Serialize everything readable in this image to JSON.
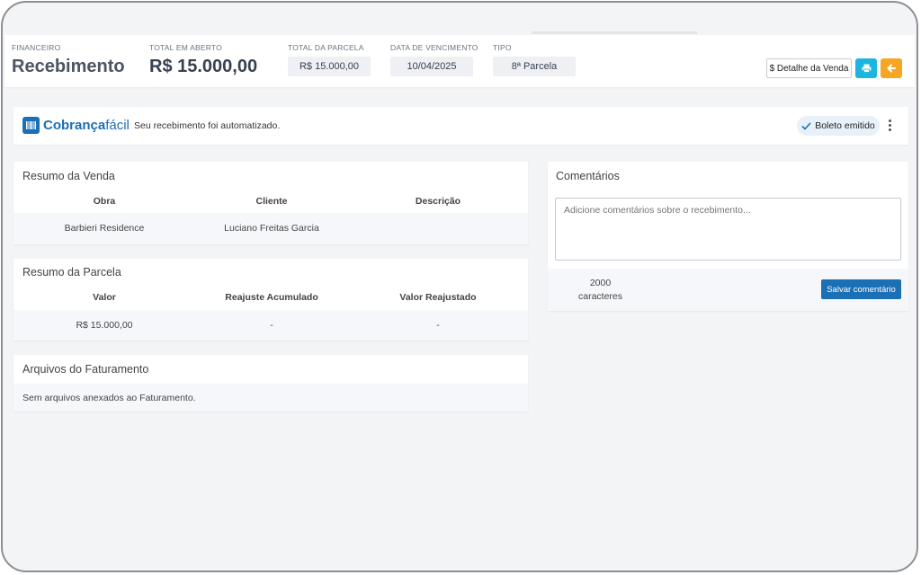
{
  "header": {
    "section_label": "FINANCEIRO",
    "title": "Recebimento",
    "total_aberto_label": "TOTAL EM ABERTO",
    "total_aberto_value": "R$ 15.000,00",
    "total_parcela_label": "TOTAL DA PARCELA",
    "total_parcela_value": "R$ 15.000,00",
    "vencimento_label": "DATA DE VENCIMENTO",
    "vencimento_value": "10/04/2025",
    "tipo_label": "TIPO",
    "tipo_value": "8ª Parcela",
    "detalhe_button": "$ Detalhe da Venda",
    "print_icon": "printer-icon",
    "back_icon": "arrow-left-icon"
  },
  "cobranca": {
    "logo_bold": "Cobrança",
    "logo_light": "fácil",
    "message": "Seu recebimento foi automatizado.",
    "badge": "Boleto emitido",
    "badge_icon": "check-icon",
    "menu_icon": "kebab-menu-icon"
  },
  "resumo_venda": {
    "title": "Resumo da Venda",
    "columns": [
      "Obra",
      "Cliente",
      "Descrição"
    ],
    "row": [
      "Barbieri Residence",
      "Luciano Freitas Garcia",
      ""
    ]
  },
  "resumo_parcela": {
    "title": "Resumo da Parcela",
    "columns": [
      "Valor",
      "Reajuste Acumulado",
      "Valor Reajustado"
    ],
    "row": [
      "R$ 15.000,00",
      "-",
      "-"
    ]
  },
  "arquivos": {
    "title": "Arquivos do Faturamento",
    "empty_message": "Sem arquivos anexados ao Faturamento."
  },
  "comentarios": {
    "title": "Comentários",
    "placeholder": "Adicione comentários sobre o recebimento...",
    "char_count": "2000",
    "char_label": "caracteres",
    "save_button": "Salvar comentário"
  },
  "colors": {
    "primary": "#1b6fb5",
    "print_button": "#1cb5e0",
    "back_button": "#f5a623"
  }
}
